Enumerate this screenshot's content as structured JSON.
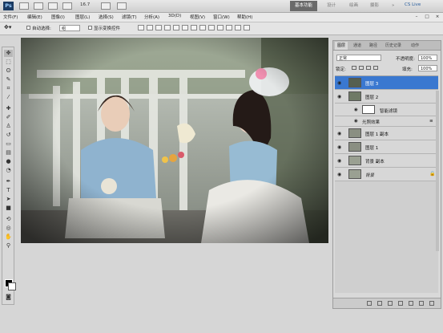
{
  "app": {
    "logo": "Ps",
    "zoom_level": "16.7",
    "workspaces": [
      "基本功能",
      "设计",
      "绘画",
      "摄影"
    ],
    "more": "»",
    "cs_live": "CS Live",
    "window_controls": {
      "minimize": "–",
      "maximize": "□",
      "close": "×"
    }
  },
  "menu": [
    "文件(F)",
    "编辑(E)",
    "图像(I)",
    "图层(L)",
    "选择(S)",
    "滤镜(T)",
    "分析(A)",
    "3D(D)",
    "视图(V)",
    "窗口(W)",
    "帮助(H)"
  ],
  "options": {
    "auto_select_label": "自动选择:",
    "auto_select_value": "组",
    "show_transform_label": "显示变换控件"
  },
  "panel": {
    "tabs": [
      "图层",
      "通道",
      "路径",
      "历史记录",
      "动作"
    ],
    "blend_mode": "正常",
    "opacity_label": "不透明度:",
    "opacity_value": "100%",
    "lock_label": "锁定:",
    "fill_label": "填充:",
    "fill_value": "100%",
    "layers": [
      {
        "name": "图层 3",
        "selected": true
      },
      {
        "name": "图层 2",
        "selected": false
      },
      {
        "name": "智能滤镜",
        "selected": false
      },
      {
        "name": "光照效果",
        "selected": false
      },
      {
        "name": "图层 1 副本",
        "selected": false
      },
      {
        "name": "图层 1",
        "selected": false
      },
      {
        "name": "背景 副本",
        "selected": false
      },
      {
        "name": "背景",
        "selected": false
      }
    ]
  },
  "colors": {
    "accent_selected": "#3a78d0",
    "foreground": "#000000",
    "background": "#ffffff"
  }
}
